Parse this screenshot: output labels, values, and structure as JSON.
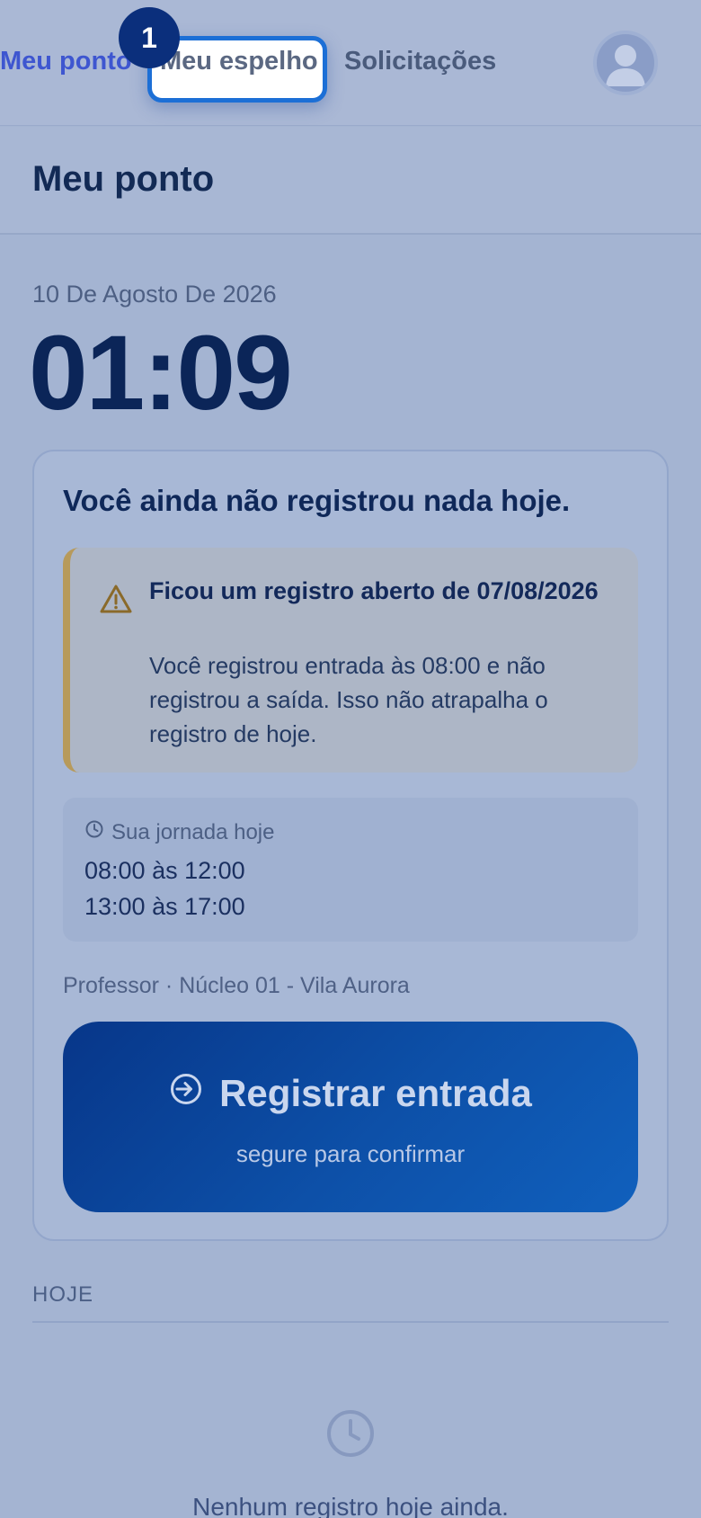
{
  "nav": {
    "items": [
      {
        "label": "Meu ponto",
        "active": true
      },
      {
        "label": "Meu espelho",
        "highlighted": true
      },
      {
        "label": "Solicitações"
      }
    ],
    "step_badge": "1",
    "avatar_icon": "user-avatar-icon"
  },
  "header": {
    "title": "Meu ponto"
  },
  "clock": {
    "date": "10 De Agosto De 2026",
    "time": "01:09"
  },
  "card": {
    "title": "Você ainda não registrou nada hoje.",
    "warning": {
      "icon": "warning-triangle-icon",
      "title": "Ficou um registro aberto de 07/08/2026",
      "text": "Você registrou entrada às 08:00 e não registrou a saída. Isso não atrapalha o registro de hoje."
    },
    "journey": {
      "icon": "clock-icon",
      "heading": "Sua jornada hoje",
      "shifts": [
        "08:00 às 12:00",
        "13:00 às 17:00"
      ]
    },
    "role": "Professor · Núcleo 01 - Vila Aurora",
    "register_button": {
      "icon": "sign-in-icon",
      "label": "Registrar entrada",
      "sublabel": "segure para confirmar"
    }
  },
  "today": {
    "label": "HOJE",
    "empty_icon": "clock-icon",
    "empty_text": "Nenhum registro hoje ainda."
  },
  "colors": {
    "accent": "#1c6fd6",
    "badge": "#0b2f7c",
    "warning_border": "#b79a5b",
    "button_start": "#073689",
    "button_end": "#1060bd"
  }
}
